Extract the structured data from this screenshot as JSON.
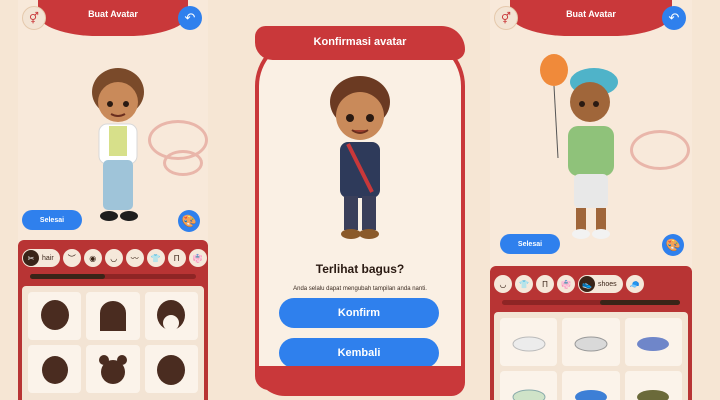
{
  "left": {
    "title": "Buat Avatar",
    "done_label": "Selesai",
    "active_category_label": "hair",
    "categories": [
      "hair-icon",
      "eyebrow-icon",
      "eyes-icon",
      "mouth-icon",
      "mustache-icon",
      "shirt-icon",
      "pants-icon",
      "outfit-icon"
    ],
    "options": [
      "hair-option-1",
      "hair-option-2",
      "hair-option-3",
      "hair-option-4",
      "hair-option-5",
      "hair-option-6"
    ]
  },
  "modal": {
    "title": "Konfirmasi avatar",
    "question": "Terlihat bagus?",
    "subtext": "Anda selalu dapat mengubah tampilan anda nanti.",
    "confirm_label": "Konfirm",
    "back_label": "Kembali"
  },
  "right": {
    "title": "Buat Avatar",
    "done_label": "Selesai",
    "active_category_label": "shoes",
    "categories": [
      "mouth-icon",
      "shirt-icon",
      "pants-icon",
      "outfit-icon",
      "hat-icon"
    ],
    "options": [
      "sneaker-white",
      "sneaker-grey",
      "sneaker-blue",
      "shoe-green",
      "shoe-blue",
      "shoe-olive"
    ]
  },
  "colors": {
    "accent_red": "#c9383a",
    "button_blue": "#2f80ed",
    "background": "#f6e6d4"
  }
}
